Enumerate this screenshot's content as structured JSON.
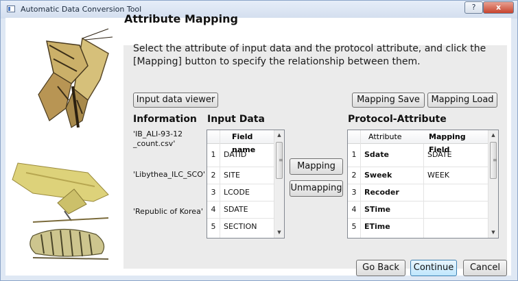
{
  "window": {
    "title": "Automatic Data Conversion Tool",
    "help_glyph": "?",
    "close_glyph": "x"
  },
  "page": {
    "heading": "Attribute Mapping",
    "instruction_line1": "Select the attribute of input data and the protocol attribute, and click the",
    "instruction_line2": "[Mapping] button to specify the relationship between them."
  },
  "toolbar": {
    "input_viewer": "Input data viewer",
    "mapping_save": "Mapping Save",
    "mapping_load": "Mapping Load"
  },
  "information": {
    "header": "Information",
    "file_line1": "'IB_ALI-93-12",
    "file_line2": "_count.csv'",
    "species": "'Libythea_ILC_SCO'",
    "country": "'Republic of Korea'"
  },
  "input_data": {
    "header": "Input Data",
    "column": "Field name",
    "rows": [
      {
        "n": "1",
        "field": "DATID"
      },
      {
        "n": "2",
        "field": "SITE"
      },
      {
        "n": "3",
        "field": "LCODE"
      },
      {
        "n": "4",
        "field": "SDATE"
      },
      {
        "n": "5",
        "field": "SECTION"
      }
    ]
  },
  "actions": {
    "mapping": "Mapping",
    "unmapping": "Unmapping"
  },
  "protocol": {
    "header": "Protocol-Attribute",
    "col_attribute": "Attribute",
    "col_mapping": "Mapping Field",
    "rows": [
      {
        "n": "1",
        "attr": "Sdate",
        "map": "SDATE"
      },
      {
        "n": "2",
        "attr": "Sweek",
        "map": "WEEK"
      },
      {
        "n": "3",
        "attr": "Recoder",
        "map": ""
      },
      {
        "n": "4",
        "attr": "STime",
        "map": ""
      },
      {
        "n": "5",
        "attr": "ETime",
        "map": ""
      }
    ]
  },
  "footer": {
    "go_back": "Go Back",
    "continue": "Continue",
    "cancel": "Cancel"
  },
  "scroll": {
    "up": "▲",
    "down": "▼",
    "grip": "≡"
  },
  "colors": {
    "panel": "#ebebeb",
    "primary_border": "#3c7fb1",
    "close": "#c8442e"
  }
}
